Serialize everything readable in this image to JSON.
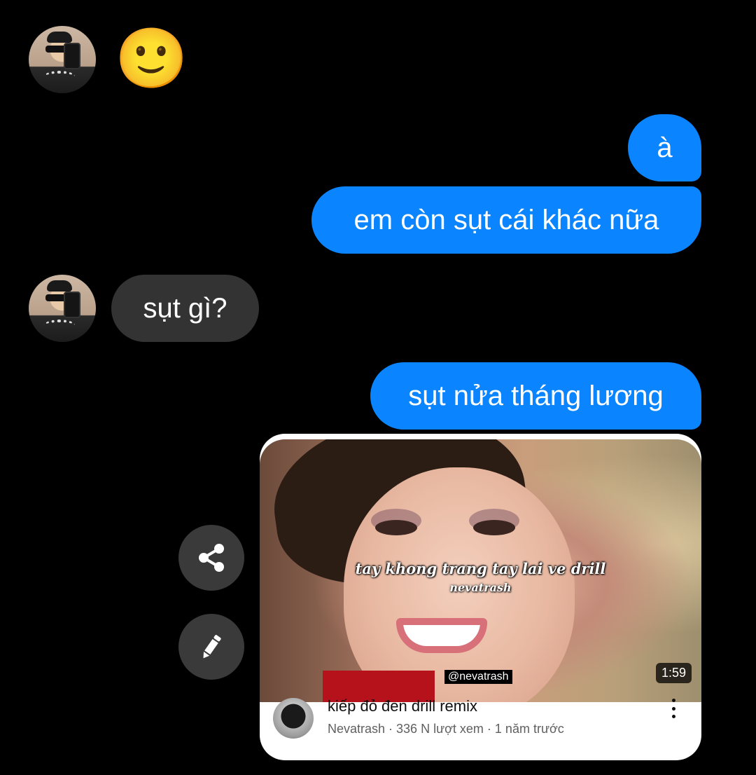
{
  "messages": {
    "first_reaction": "🙂",
    "out_1": "à",
    "out_2": "em còn sụt cái khác nữa",
    "in_1": "sụt gì?",
    "out_3": "sụt nửa tháng lương"
  },
  "video_card": {
    "overlay_caption": "tay khong trang tay lai ve drill",
    "overlay_channel": "nevatrash",
    "watermark": "@nevatrash",
    "duration": "1:59",
    "title": "kiếp đỏ đen drill remix",
    "meta": "Nevatrash · 336 N lượt xem · 1 năm trước"
  },
  "colors": {
    "outgoing_bubble": "#0a84ff",
    "incoming_bubble": "#333333",
    "background": "#000000"
  },
  "icons": [
    "share-icon",
    "edit-pencil-icon",
    "more-vertical-icon"
  ]
}
